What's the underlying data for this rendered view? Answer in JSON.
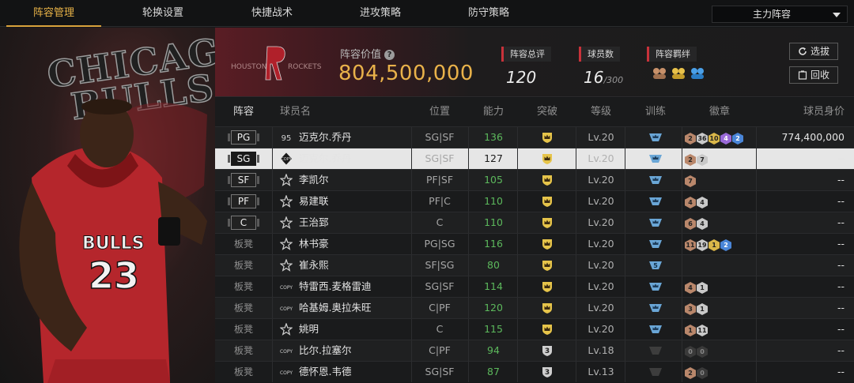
{
  "nav": {
    "tabs": [
      {
        "label": "阵容管理",
        "active": true
      },
      {
        "label": "轮换设置",
        "active": false
      },
      {
        "label": "快捷战术",
        "active": false
      },
      {
        "label": "进攻策略",
        "active": false
      },
      {
        "label": "防守策略",
        "active": false
      }
    ],
    "lineup_select": "主力阵容"
  },
  "art": {
    "team_text_line1": "CHICAGO",
    "team_text_line2": "BULLS"
  },
  "banner": {
    "team_logo_text": "HOUSTON ROCKETS",
    "value_label": "阵容价值",
    "value": "804,500,000",
    "stats": [
      {
        "label": "阵容总评",
        "value": "120"
      },
      {
        "label": "球员数",
        "value": "16",
        "sub": "/300"
      },
      {
        "label": "阵容羁绊"
      }
    ],
    "buttons": {
      "select": "选拔",
      "recycle": "回收"
    }
  },
  "table": {
    "headers": [
      "阵容",
      "球员名",
      "位置",
      "能力",
      "突破",
      "等级",
      "训练",
      "徽章",
      "球员身价"
    ],
    "rows": [
      {
        "slot": "PG",
        "bench": false,
        "icon": "95",
        "name": "迈克尔.乔丹",
        "role": "SG|SF",
        "ability": "136",
        "break": "crown",
        "level": "Lv.20",
        "training": "crown",
        "badges": [
          [
            "bronze",
            "2"
          ],
          [
            "silver",
            "36"
          ],
          [
            "gold",
            "10"
          ],
          [
            "purple",
            "4"
          ],
          [
            "blue",
            "2"
          ]
        ],
        "price": "774,400,000",
        "selected": false
      },
      {
        "slot": "SG",
        "bench": false,
        "icon": "COPY",
        "name": "迈克尔.乔丹",
        "role": "SG|SF",
        "ability": "127",
        "break": "crown",
        "level": "Lv.20",
        "training": "crown",
        "badges": [
          [
            "bronze",
            "2"
          ],
          [
            "silver",
            "7"
          ]
        ],
        "price": "--",
        "selected": true
      },
      {
        "slot": "SF",
        "bench": false,
        "icon": "star",
        "name": "李凯尔",
        "role": "PF|SF",
        "ability": "105",
        "break": "crown",
        "level": "Lv.20",
        "training": "crown",
        "badges": [
          [
            "bronze",
            "7"
          ]
        ],
        "price": "--",
        "selected": false
      },
      {
        "slot": "PF",
        "bench": false,
        "icon": "star",
        "name": "易建联",
        "role": "PF|C",
        "ability": "110",
        "break": "crown",
        "level": "Lv.20",
        "training": "crown",
        "badges": [
          [
            "bronze",
            "4"
          ],
          [
            "silver",
            "4"
          ]
        ],
        "price": "--",
        "selected": false
      },
      {
        "slot": "C",
        "bench": false,
        "icon": "star",
        "name": "王治郅",
        "role": "C",
        "ability": "110",
        "break": "crown",
        "level": "Lv.20",
        "training": "crown",
        "badges": [
          [
            "bronze",
            "6"
          ],
          [
            "silver",
            "4"
          ]
        ],
        "price": "--",
        "selected": false
      },
      {
        "slot": "板凳",
        "bench": true,
        "icon": "star",
        "name": "林书豪",
        "role": "PG|SG",
        "ability": "116",
        "break": "crown",
        "level": "Lv.20",
        "training": "crown",
        "badges": [
          [
            "bronze",
            "11"
          ],
          [
            "silver",
            "19"
          ],
          [
            "gold",
            "1"
          ],
          [
            "blue",
            "2"
          ]
        ],
        "price": "--",
        "selected": false
      },
      {
        "slot": "板凳",
        "bench": true,
        "icon": "star",
        "name": "崔永熙",
        "role": "SF|SG",
        "ability": "80",
        "break": "crown",
        "level": "Lv.20",
        "training": "5",
        "badges": [],
        "price": "--",
        "selected": false
      },
      {
        "slot": "板凳",
        "bench": true,
        "icon": "COPY",
        "name": "特雷西.麦格雷迪",
        "role": "SG|SF",
        "ability": "114",
        "break": "crown",
        "level": "Lv.20",
        "training": "crown",
        "badges": [
          [
            "bronze",
            "4"
          ],
          [
            "silver",
            "1"
          ]
        ],
        "price": "--",
        "selected": false
      },
      {
        "slot": "板凳",
        "bench": true,
        "icon": "COPY",
        "name": "哈基姆.奥拉朱旺",
        "role": "C|PF",
        "ability": "120",
        "break": "crown",
        "level": "Lv.20",
        "training": "crown",
        "badges": [
          [
            "bronze",
            "3"
          ],
          [
            "silver",
            "1"
          ]
        ],
        "price": "--",
        "selected": false
      },
      {
        "slot": "板凳",
        "bench": true,
        "icon": "star",
        "name": "姚明",
        "role": "C",
        "ability": "115",
        "break": "crown",
        "level": "Lv.20",
        "training": "crown",
        "badges": [
          [
            "bronze",
            "1"
          ],
          [
            "silver",
            "11"
          ]
        ],
        "price": "--",
        "selected": false
      },
      {
        "slot": "板凳",
        "bench": true,
        "icon": "COPY",
        "name": "比尔.拉塞尔",
        "role": "C|PF",
        "ability": "94",
        "break": "3",
        "level": "Lv.18",
        "training": "locked",
        "badges": [
          [
            "dark",
            "0"
          ],
          [
            "dark",
            "0"
          ]
        ],
        "price": "--",
        "selected": false
      },
      {
        "slot": "板凳",
        "bench": true,
        "icon": "COPY",
        "name": "德怀恩.韦德",
        "role": "SG|SF",
        "ability": "87",
        "break": "3",
        "level": "Lv.13",
        "training": "locked",
        "badges": [
          [
            "bronze",
            "2"
          ],
          [
            "dark",
            "0"
          ]
        ],
        "price": "--",
        "selected": false
      }
    ]
  }
}
